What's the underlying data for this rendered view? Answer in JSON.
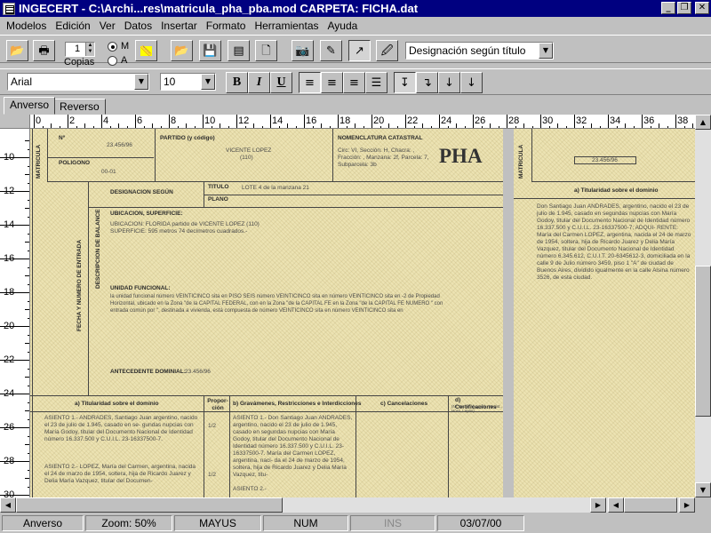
{
  "window": {
    "title": "INGECERT - C:\\Archi...res\\matricula_pha_pba.mod    CARPETA: FICHA.dat"
  },
  "menu": [
    {
      "label": "Modelos",
      "accel": "M"
    },
    {
      "label": "Edición",
      "accel": "E"
    },
    {
      "label": "Ver",
      "accel": "V"
    },
    {
      "label": "Datos",
      "accel": "D"
    },
    {
      "label": "Insertar",
      "accel": "I"
    },
    {
      "label": "Formato",
      "accel": "F"
    },
    {
      "label": "Herramientas",
      "accel": "H"
    },
    {
      "label": "Ayuda",
      "accel": "A"
    }
  ],
  "toolbar": {
    "copies_value": "1",
    "copies_label": "Copias",
    "radio_m_label": "M",
    "radio_a_label": "A",
    "selected_radio": "M",
    "field_combo_value": "Designación según título",
    "font_combo_value": "Arial",
    "size_combo_value": "10",
    "bold_label": "B",
    "italic_label": "I",
    "underline_label": "U",
    "icons": [
      "open-folder-icon",
      "printer-icon",
      "ruler-tool-icon",
      "open-file-icon",
      "save-icon",
      "table-icon",
      "new-page-icon",
      "camera-icon",
      "edit-folder-icon",
      "zoom-tool-icon",
      "image-edit-icon"
    ]
  },
  "tabs": {
    "front": "Anverso",
    "back": "Reverso",
    "active": "Anverso"
  },
  "ruler_h": [
    "0",
    "2",
    "4",
    "6",
    "8",
    "10",
    "12",
    "14",
    "16",
    "18",
    "20",
    "22",
    "24",
    "26",
    "28",
    "30",
    "32",
    "34",
    "36",
    "38"
  ],
  "ruler_v": [
    "10",
    "12",
    "14",
    "16",
    "18",
    "20",
    "22",
    "24",
    "26",
    "28",
    "30"
  ],
  "form": {
    "matricula_label": "MATRICULA",
    "n_label": "Nº",
    "n_value": "23.456/96",
    "poligono_label": "POLIGONO",
    "poligono_value": "00-01",
    "partido_label": "PARTIDO (y código)",
    "partido_value": "VICENTE LOPEZ",
    "partido_code": "(110)",
    "nomenclatura_label": "NOMENCLATURA CATASTRAL",
    "nomenclatura_line1": "Circ: VI, Sección: H, Chacra: ,",
    "nomenclatura_line2": "Fracción: , Manzana: 2f, Parcela: 7,",
    "nomenclatura_line3": "Subparcela: 3b",
    "pha_label": "PHA",
    "designacion_label": "DESIGNACION SEGÚN",
    "titulo_label": "TITULO",
    "titulo_value": "LOTE 4 de la manzana 21",
    "plano_label": "PLANO",
    "ubicacion_label": "UBICACION, SUPERFICIE:",
    "ubicacion_line1": "UBICACION: FLORIDA partido de VICENTE LOPEZ (110)",
    "ubicacion_line2": "SUPERFICIE: 595 metros 74 decímetros cuadrados.-",
    "fecha_label": "FECHA Y NUMERO DE ENTRADA",
    "descripcion_label": "DESCRIPCION DE BALANCE",
    "unidad_label": "UNIDAD FUNCIONAL:",
    "unidad_line1": "la unidad funcional número VEINTICINCO sita en  PISO SEIS número VEINTICINCO sita en  número VEINTICINCO sita en  -2 de Propiedad",
    "unidad_line2": "Horizontal, ubicado en la Zona \"de la CAPITAL FEDERAL, con en la Zona \"de la CAPITAL FE en la Zona \"de la CAPITAL FE NUMERO \" con",
    "unidad_line3": "entrada común por \", destinada a vivienda, está compuesta de  número VEINTICINCO sita en  número VEINTICINCO sita en",
    "antecedente_label": "ANTECEDENTE DOMINIAL:",
    "antecedente_value": "23.456/96",
    "col_a_header": "a) Titularidad sobre el dominio",
    "col_prop_header": "Propor-ción",
    "col_b_header": "b) Gravámenes, Restricciones e Interdicciones",
    "col_c_header": "c) Cancelaciones",
    "col_d_header": "d) Certificaciones",
    "col_d_sub": "(Nº Fecha Abogado, Regist., Hora, Leyes)",
    "asiento1_a": "ASIENTO 1.- ANDRADES, Santiago Juan argentino, nacido el 23 de julio de 1.945, casado en se- gundas nupcias con María Godoy, titular del Documento Nacional de Identidad número 16.337.500 y C.U.I.L. 23-16337500-7.",
    "asiento2_a": "ASIENTO 2.- LOPEZ, María del Carmen, argentina, nacida el 24 de marzo de 1954, soltera, hija de Ricardo Juarez y Delia María Vazquez, titular del Documen-",
    "prop1": "1/2",
    "prop2": "1/2",
    "asiento1_b": "ASIENTO 1.- Don Santiago Juan ANDRADES, argentino, nacido el 23 de julio de 1.945, casado en segundas nupcias con María Godoy, titular del Documento Nacional de Identidad número 16.337.500 y C.U.I.L. 23-16337500-7. María del Carmen LOPEZ, argentina, naci- da el 24 de marzo de 1954, soltera, hija de Ricardo Juarez y Delia María Vazquez, titu-",
    "asiento2_b": "ASIENTO 2.-",
    "page2_matricula_label": "MATRICULA",
    "page2_number": "23.456/96",
    "page2_col_header": "a) Titularidad sobre el dominio",
    "page2_text": "Don Santiago Juan ANDRADES, argentino, nacido el 23 de julio de 1.945, casado en segundas nupcias con María Godoy, titular del Documento Nacional de Identidad número 16.337.500 y C.U.I.L. 23-16337500-7; ADQUI- RENTE: María del Carmen LOPEZ, argentina, nacida el 24 de marzo de 1954, soltera, hija de Ricardo Juarez y Delia María Vazquez, titular del Documento Nacional de Identidad número 6.345.612, C.U.I.T. 20-6345612-3, domiciliada en la calle 9 de Julio número 3459, piso 1 \"A\" de ciudad de Buenos Aires, dividido igualmente en la calle Alsina número 3526, de esta ciudad."
  },
  "status": {
    "view": "Anverso",
    "zoom": "Zoom:  50%",
    "caps": "MAYUS",
    "num": "NUM",
    "ins": "INS",
    "date": "03/07/00"
  }
}
